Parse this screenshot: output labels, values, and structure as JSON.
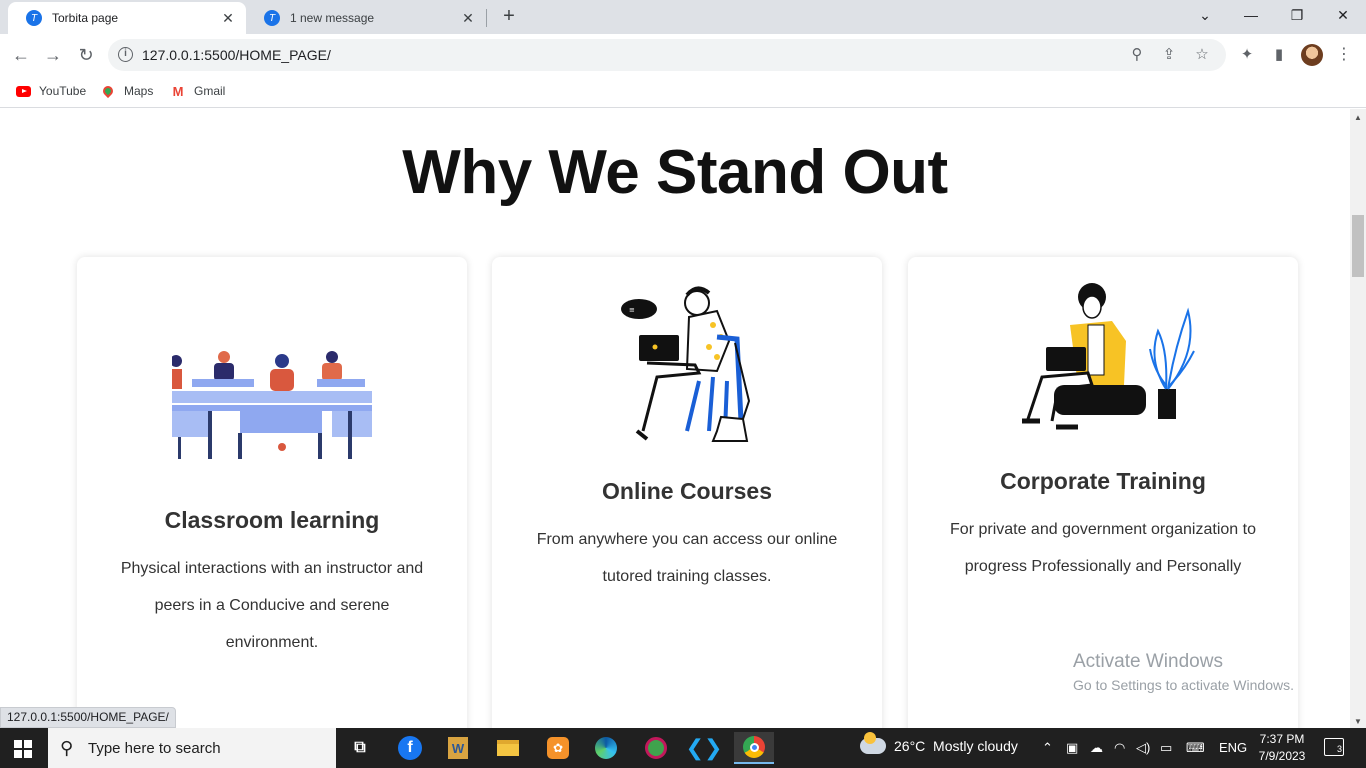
{
  "browser": {
    "tabs": [
      {
        "title": "Torbita page",
        "favicon": "torbita-logo-icon"
      },
      {
        "title": "1 new message",
        "favicon": "torbita-logo-icon"
      }
    ],
    "url": "127.0.0.1:5500/HOME_PAGE/",
    "bookmarks": [
      {
        "label": "YouTube",
        "icon": "youtube-icon"
      },
      {
        "label": "Maps",
        "icon": "maps-icon"
      },
      {
        "label": "Gmail",
        "icon": "gmail-icon"
      }
    ],
    "status_url": "127.0.0.1:5500/HOME_PAGE/"
  },
  "page": {
    "heading": "Why We Stand Out",
    "cards": [
      {
        "title": "Classroom learning",
        "text": "Physical interactions with an instructor and peers in a Conducive and serene environment.",
        "illustration": "classroom-illustration"
      },
      {
        "title": "Online Courses",
        "text": "From anywhere you can access our online tutored training classes.",
        "illustration": "online-courses-illustration"
      },
      {
        "title": "Corporate Training",
        "text": "For private and government organization to progress Professionally and Personally",
        "illustration": "corporate-training-illustration"
      }
    ]
  },
  "watermark": {
    "line1": "Activate Windows",
    "line2": "Go to Settings to activate Windows."
  },
  "taskbar": {
    "search_placeholder": "Type here to search",
    "weather": "26°C  Mostly cloudy",
    "language": "ENG",
    "time": "7:37 PM",
    "date": "7/9/2023",
    "notifications": "3"
  },
  "colors": {
    "accent_blue": "#1a73e8",
    "illustration_blue": "#8fa8f0",
    "illustration_yellow": "#f7c325"
  }
}
